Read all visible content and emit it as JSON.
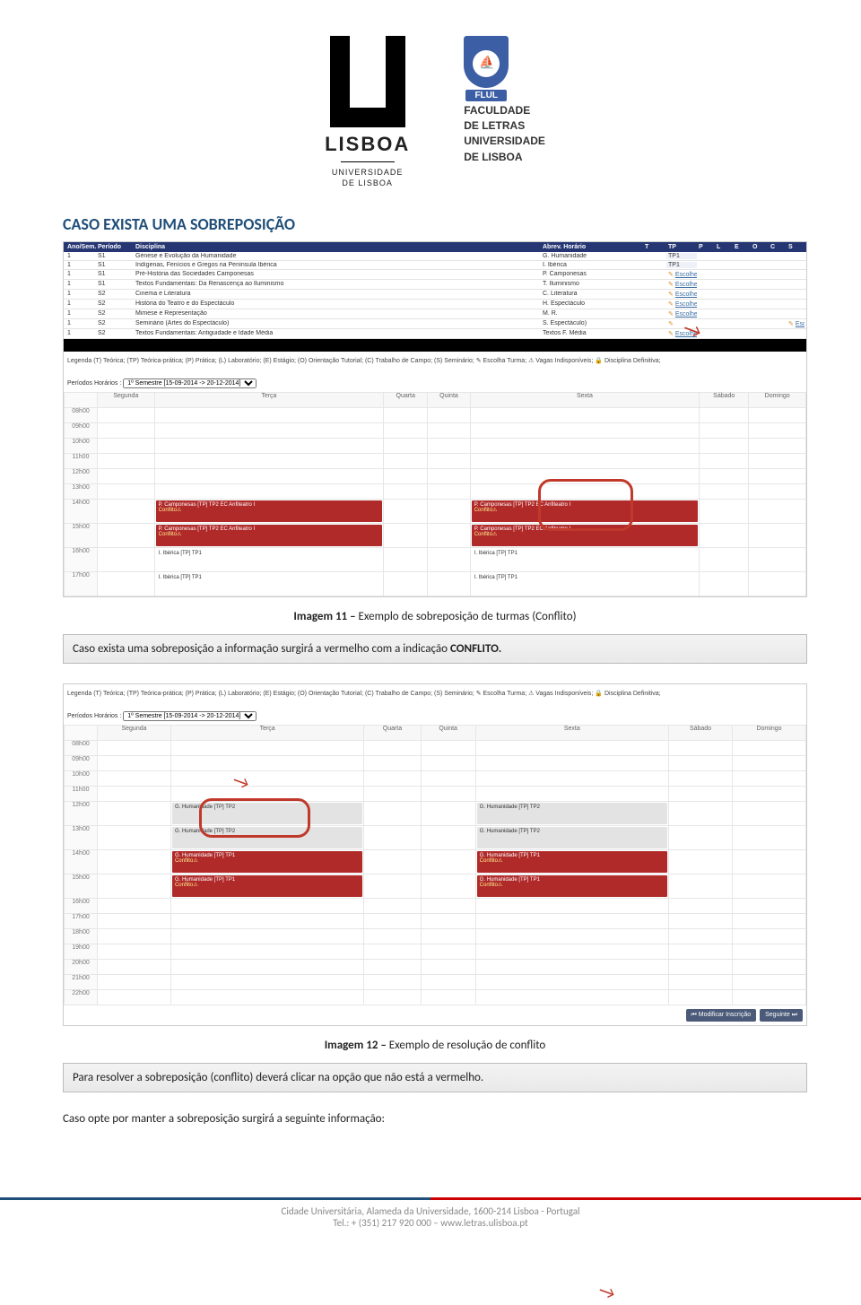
{
  "logos": {
    "lisboa": {
      "title": "LISBOA",
      "sub1": "UNIVERSIDADE",
      "sub2": "DE LISBOA"
    },
    "flul": {
      "badge": "FLUL",
      "line1": "FACULDADE",
      "line2": "DE LETRAS",
      "line3": "UNIVERSIDADE",
      "line4": "DE LISBOA"
    }
  },
  "heading": "CASO EXISTA UMA SOBREPOSIÇÃO",
  "caption1": {
    "b": "Imagem 11 –",
    "t": " Exemplo de sobreposição de turmas (Conflito)"
  },
  "note1": {
    "pre": "Caso exista uma sobreposição a informação surgirá a vermelho com a indicação ",
    "b": "CONFLITO.",
    "post": ""
  },
  "caption2": {
    "b": "Imagem 12 –",
    "t": " Exemplo de resolução de conflito"
  },
  "note2": "Para resolver a sobreposição (conflito) deverá clicar na opção que não está a vermelho.",
  "para3": "Caso opte por manter a sobreposição surgirá a seguinte informação:",
  "footer": {
    "addr": "Cidade Universitária, Alameda da Universidade, 1600-214 Lisboa - Portugal",
    "tel": "Tel.: + (351) 217 920 000 – www.letras.ulisboa.pt"
  },
  "shot1": {
    "headers": [
      "Ano/Sem.",
      "Período",
      "Disciplina",
      "Abrev. Horário",
      "T",
      "TP",
      "P",
      "L",
      "E",
      "O",
      "C",
      "S"
    ],
    "rows": [
      {
        "ano": "1",
        "per": "S1",
        "disc": "Génese e Evolução da Humanidade",
        "abrev": "G. Humanidade",
        "t": "",
        "tp": "TP1",
        "pick": ""
      },
      {
        "ano": "1",
        "per": "S1",
        "disc": "Indígenas, Fenícios e Gregos na Península Ibérica",
        "abrev": "I. Ibérica",
        "t": "",
        "tp": "TP1",
        "pick": ""
      },
      {
        "ano": "1",
        "per": "S1",
        "disc": "Pré-História das Sociedades Camponesas",
        "abrev": "P. Camponesas",
        "t": "",
        "tp": "Escolher",
        "pick": "1"
      },
      {
        "ano": "1",
        "per": "S1",
        "disc": "Textos Fundamentais: Da Renascença ao Iluminismo",
        "abrev": "T. Iluminismo",
        "t": "",
        "tp": "Escolher",
        "pick": "1"
      },
      {
        "ano": "1",
        "per": "S2",
        "disc": "Cinema e Literatura",
        "abrev": "C. Literatura",
        "t": "",
        "tp": "Escolher",
        "pick": "1"
      },
      {
        "ano": "1",
        "per": "S2",
        "disc": "História do Teatro e do Espectáculo",
        "abrev": "H. Espectáculo",
        "t": "",
        "tp": "Escolher",
        "pick": "1"
      },
      {
        "ano": "1",
        "per": "S2",
        "disc": "Mimese e Representação",
        "abrev": "M. R.",
        "t": "",
        "tp": "Escolher",
        "pick": "1"
      },
      {
        "ano": "1",
        "per": "S2",
        "disc": "Seminário (Artes do Espectáculo)",
        "abrev": "S. Espectáculo)",
        "t": "",
        "tp": "",
        "s": "Escolher",
        "pick": "1"
      },
      {
        "ano": "1",
        "per": "S2",
        "disc": "Textos Fundamentais: Antiguidade e Idade Média",
        "abrev": "Textos F. Média",
        "t": "",
        "tp": "Escolher",
        "pick": "1"
      }
    ],
    "legend": "Legenda (T) Teórica; (TP) Teórica-prática; (P) Prática; (L) Laboratório; (E) Estágio; (O) Orientação Tutorial; (C) Trabalho de Campo; (S) Seminário; ✎ Escolha Turma; ⚠ Vagas Indisponíveis; 🔒 Disciplina Definitiva;",
    "period_label": "Períodos Horários :",
    "period_value": "1º Semestre [15-09-2014 -> 20-12-2014]",
    "days": [
      "",
      "Segunda",
      "Terça",
      "Quarta",
      "Quinta",
      "Sexta",
      "Sábado",
      "Domingo"
    ],
    "hours": [
      "08h00",
      "09h00",
      "10h00",
      "11h00",
      "12h00",
      "13h00",
      "14h00",
      "15h00",
      "16h00",
      "17h00"
    ],
    "blocks": {
      "terca14": "P. Camponesas [TP] TP2 EC Anfiteatro I",
      "terca14c": "Conflito",
      "terca15": "P. Camponesas [TP] TP2 EC Anfiteatro I",
      "terca15c": "Conflito",
      "sexta14": "P. Camponesas [TP] TP2 EC Anfiteatro I",
      "sexta14c": "Conflito",
      "sexta15": "P. Camponesas [TP] TP2 EC Anfiteatro I",
      "sexta15c": "Conflito",
      "terca16": "I. Ibérica [TP] TP1",
      "terca17": "I. Ibérica [TP] TP1",
      "sexta16": "I. Ibérica [TP] TP1",
      "sexta17": "I. Ibérica [TP] TP1"
    }
  },
  "shot2": {
    "legend": "Legenda (T) Teórica; (TP) Teórica-prática; (P) Prática; (L) Laboratório; (E) Estágio; (O) Orientação Tutorial; (C) Trabalho de Campo; (S) Seminário; ✎ Escolha Turma; ⚠ Vagas Indisponíveis; 🔒 Disciplina Definitiva;",
    "period_label": "Períodos Horários :",
    "period_value": "1º Semestre [15-09-2014 -> 20-12-2014]",
    "days": [
      "",
      "Segunda",
      "Terça",
      "Quarta",
      "Quinta",
      "Sexta",
      "Sábado",
      "Domingo"
    ],
    "hours": [
      "08h00",
      "09h00",
      "10h00",
      "11h00",
      "12h00",
      "13h00",
      "14h00",
      "15h00",
      "16h00",
      "17h00",
      "18h00",
      "19h00",
      "20h00",
      "21h00",
      "22h00"
    ],
    "blocks": {
      "t12": "G. Humanidade [TP] TP2",
      "t13": "G. Humanidade [TP] TP2",
      "s12": "G. Humanidade [TP] TP2",
      "s13": "G. Humanidade [TP] TP2",
      "t14": "G. Humanidade [TP] TP1",
      "t14c": "Conflito",
      "s14": "G. Humanidade [TP] TP1",
      "s14c": "Conflito",
      "t15": "G. Humanidade [TP] TP1",
      "t15c": "Conflito",
      "s15": "G. Humanidade [TP] TP1",
      "s15c": "Conflito"
    },
    "btn1": "Modificar Inscrição",
    "btn2": "Seguinte"
  }
}
